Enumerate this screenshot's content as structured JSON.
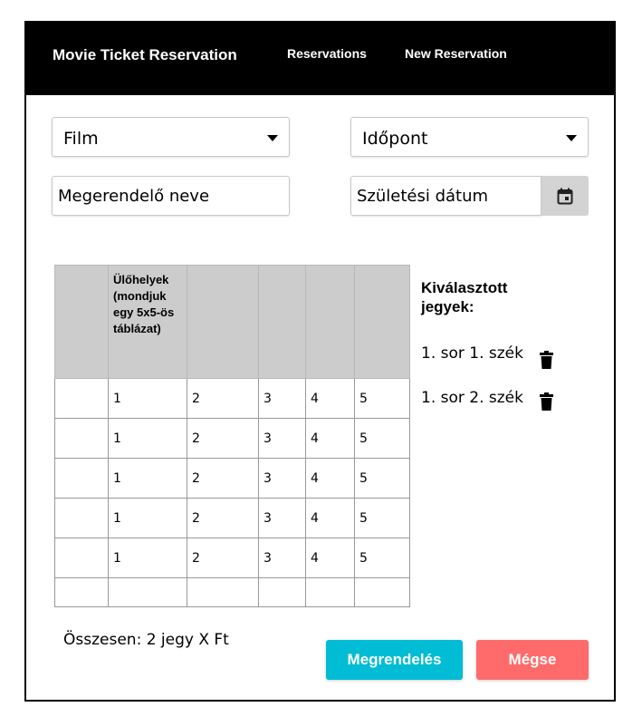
{
  "navbar": {
    "brand": "Movie Ticket Reservation",
    "links": [
      "Reservations",
      "New Reservation"
    ]
  },
  "form": {
    "film_select": "Film",
    "time_select": "Időpont",
    "name_placeholder": "Megerendelő neve",
    "birthdate_placeholder": "Születési dátum"
  },
  "seats_table": {
    "header": "Ülőhelyek (mondjuk egy 5x5-ös táblázat)",
    "rows": [
      [
        "1",
        "2",
        "3",
        "4",
        "5"
      ],
      [
        "1",
        "2",
        "3",
        "4",
        "5"
      ],
      [
        "1",
        "2",
        "3",
        "4",
        "5"
      ],
      [
        "1",
        "2",
        "3",
        "4",
        "5"
      ],
      [
        "1",
        "2",
        "3",
        "4",
        "5"
      ]
    ]
  },
  "selected": {
    "title": "Kiválasztott jegyek:",
    "tickets": [
      "1. sor 1. szék",
      "1. sor 2. szék"
    ]
  },
  "summary": {
    "total": "Összesen: 2 jegy X Ft"
  },
  "buttons": {
    "order": "Megrendelés",
    "cancel": "Mégse"
  },
  "colors": {
    "navbar": "#000000",
    "order_button": "#00bcd4",
    "cancel_button": "#ff6b6b",
    "table_header": "#cccccc"
  },
  "icons": {
    "calendar": "calendar-icon",
    "delete": "trash-icon",
    "dropdown": "caret-down-icon"
  }
}
